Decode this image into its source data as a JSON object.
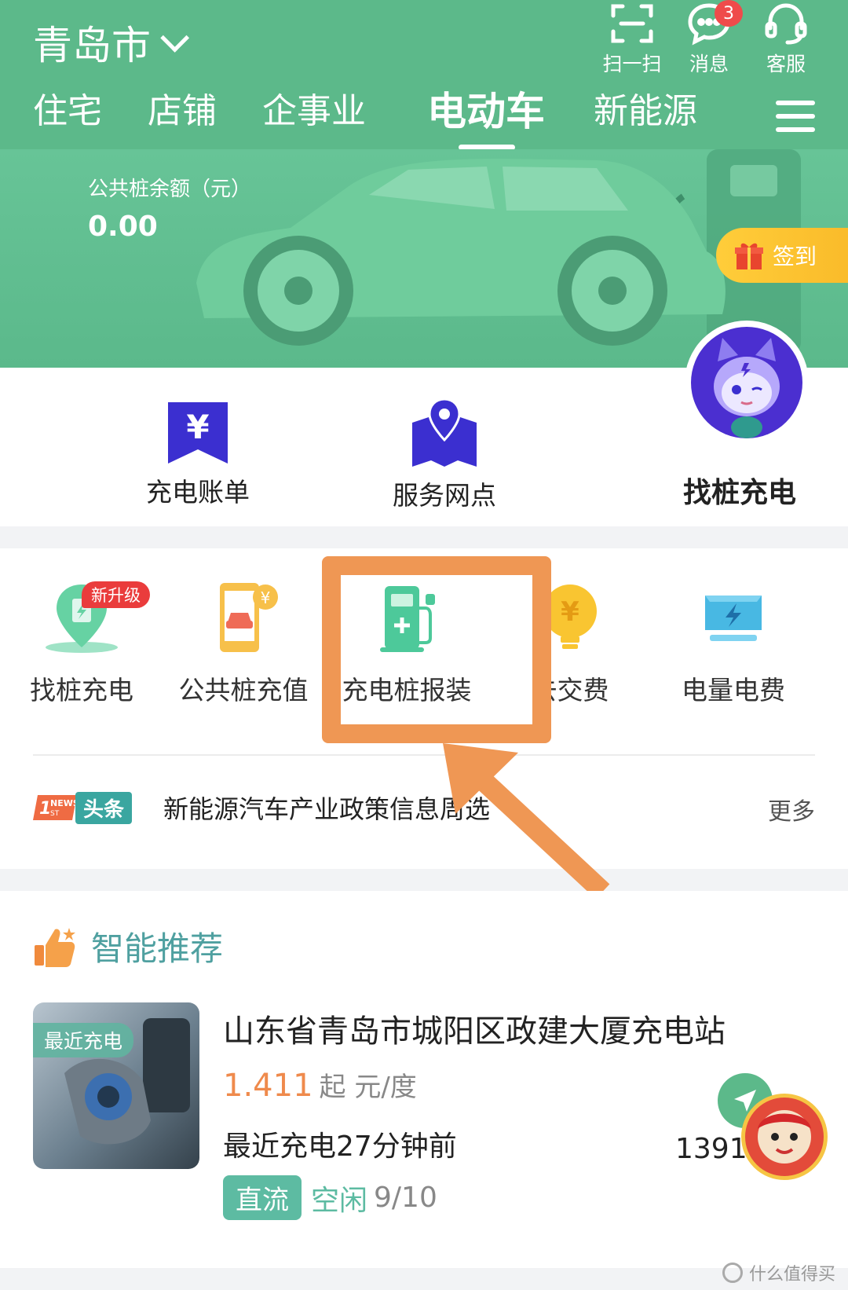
{
  "header": {
    "city": "青岛市",
    "actions": [
      {
        "label": "扫一扫",
        "icon": "scan-icon"
      },
      {
        "label": "消息",
        "icon": "message-icon",
        "badge": "3"
      },
      {
        "label": "客服",
        "icon": "headset-icon"
      }
    ],
    "tabs": [
      "住宅",
      "店铺",
      "企事业",
      "电动车",
      "新能源"
    ],
    "active_tab": "电动车"
  },
  "banner": {
    "balance_label": "公共桩余额（元）",
    "balance_value": "0.00",
    "checkin_label": "签到"
  },
  "quick": {
    "items": [
      {
        "label": "充电账单",
        "icon": "bill-icon"
      },
      {
        "label": "服务网点",
        "icon": "map-pin-icon"
      }
    ],
    "featured_label": "找桩充电"
  },
  "services": {
    "items": [
      {
        "label": "找桩充电",
        "icon": "location-charger-icon",
        "badge": "新升级"
      },
      {
        "label": "公共桩充值",
        "icon": "phone-car-icon"
      },
      {
        "label": "充电桩报装",
        "icon": "charging-pile-icon"
      },
      {
        "label": "去交费",
        "icon": "coin-bulb-icon"
      },
      {
        "label": "电量电费",
        "icon": "monitor-bolt-icon"
      }
    ],
    "news_tag": "头条",
    "news_text": "新能源汽车产业政策信息周选",
    "more": "更多"
  },
  "recommend": {
    "title": "智能推荐",
    "station": {
      "tag": "最近充电",
      "name": "山东省青岛市城阳区政建大厦充电站",
      "price": "1.411",
      "price_suffix": "起 元/度",
      "recent": "最近充电27分钟前",
      "type": "直流",
      "status": "空闲",
      "count": "9/10",
      "phone": "1391"
    }
  },
  "watermark": "什么值得买",
  "colors": {
    "primary": "#5cb98a",
    "highlight": "#ef9754",
    "price": "#ef8a4c",
    "badge": "#ea3c3c",
    "icon_purple": "#4b2fd0"
  }
}
